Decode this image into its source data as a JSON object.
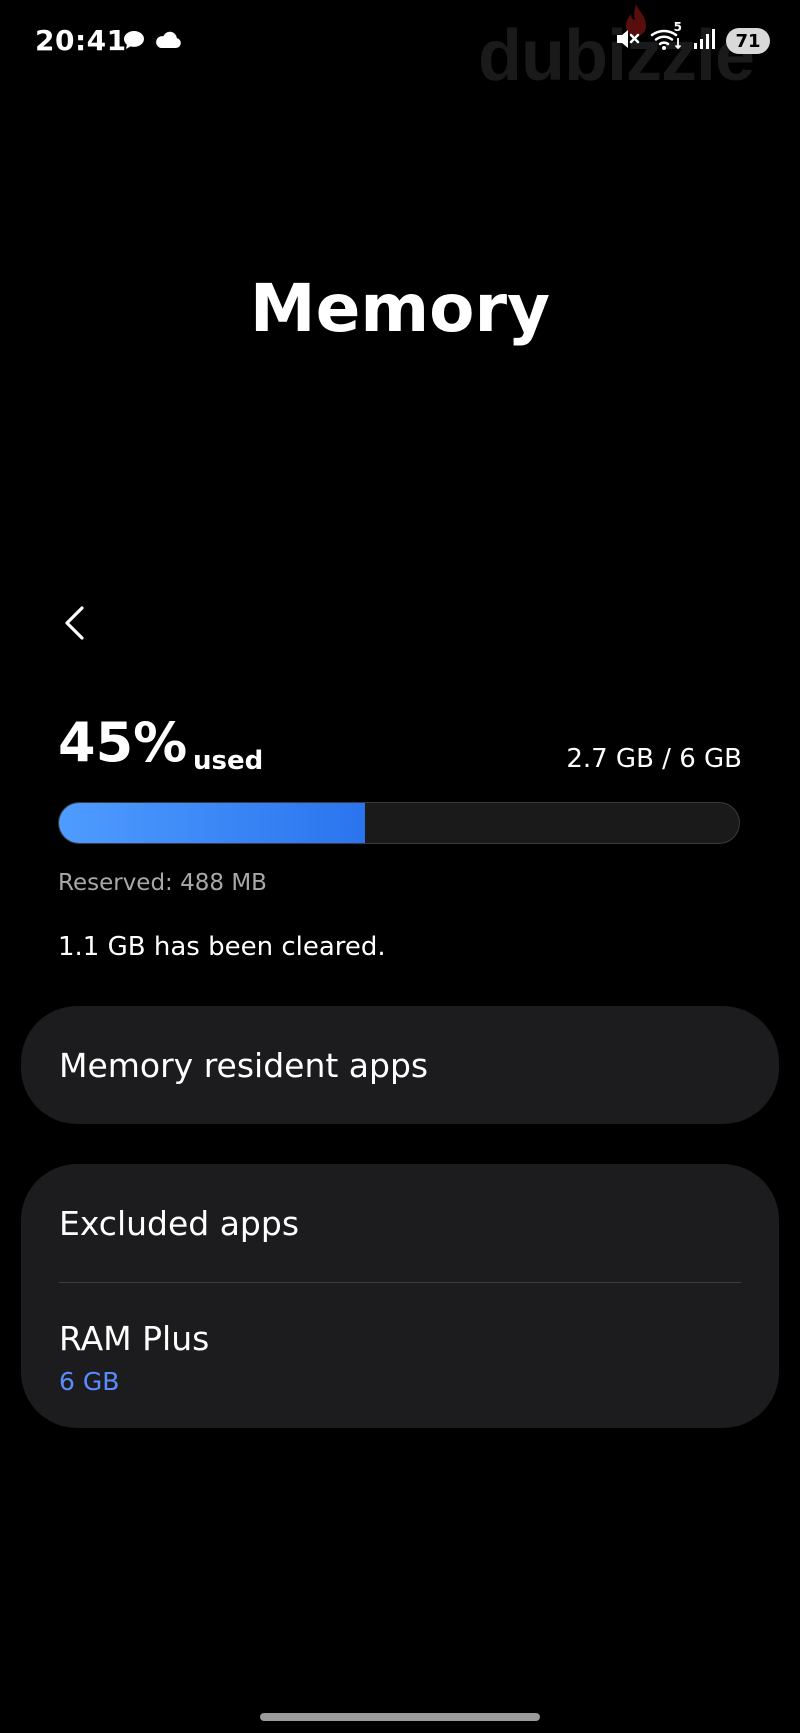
{
  "status_bar": {
    "time": "20:41",
    "left_icons": [
      "chat-bubble-icon",
      "cloud-icon"
    ],
    "right_icons": [
      "mute-icon",
      "wifi-icon",
      "signal-icon"
    ],
    "wifi_badge": "5",
    "battery": "71"
  },
  "watermark": {
    "text": "dubizzle"
  },
  "header": {
    "title": "Memory"
  },
  "memory": {
    "percent": "45%",
    "used_label": "used",
    "amount": "2.7 GB / 6 GB",
    "used_fraction": 0.45,
    "reserved": "Reserved: 488 MB",
    "cleared": "1.1 GB has been cleared."
  },
  "menu": {
    "resident_apps": "Memory resident apps",
    "excluded_apps": "Excluded apps",
    "ram_plus": {
      "label": "RAM Plus",
      "value": "6 GB"
    }
  },
  "colors": {
    "accent": "#5a8cff",
    "bar_fill_start": "#4f9cff",
    "bar_fill_end": "#2a74ee",
    "card_bg": "#1c1c1e"
  }
}
